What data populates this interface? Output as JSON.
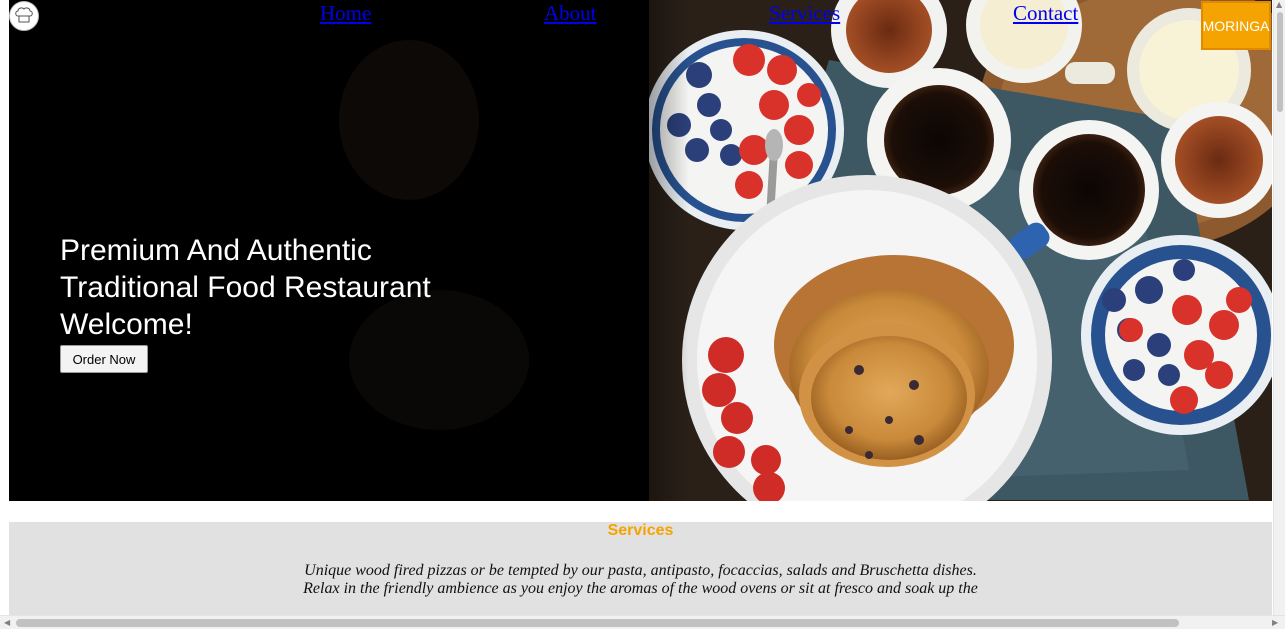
{
  "nav": {
    "links": [
      {
        "label": "Home"
      },
      {
        "label": "About"
      },
      {
        "label": "Services"
      },
      {
        "label": "Contact"
      }
    ],
    "brand_button": "MORINGA",
    "logo_icon": "chef-hat-icon"
  },
  "hero": {
    "heading_lines": [
      "Premium And Authentic",
      "Traditional Food Restaurant",
      "Welcome!"
    ],
    "cta_label": "Order Now"
  },
  "services": {
    "title": "Services",
    "text_lines": [
      "Unique wood fired pizzas or be tempted by our pasta, antipasto, focaccias, salads and Bruschetta dishes.",
      "Relax in the friendly ambience as you enjoy the aromas of the wood ovens or sit at fresco and soak up the"
    ]
  },
  "colors": {
    "accent": "#f5a300",
    "link": "#0000ee",
    "services_bg": "#e1e1e1",
    "hero_bg": "#000000"
  }
}
